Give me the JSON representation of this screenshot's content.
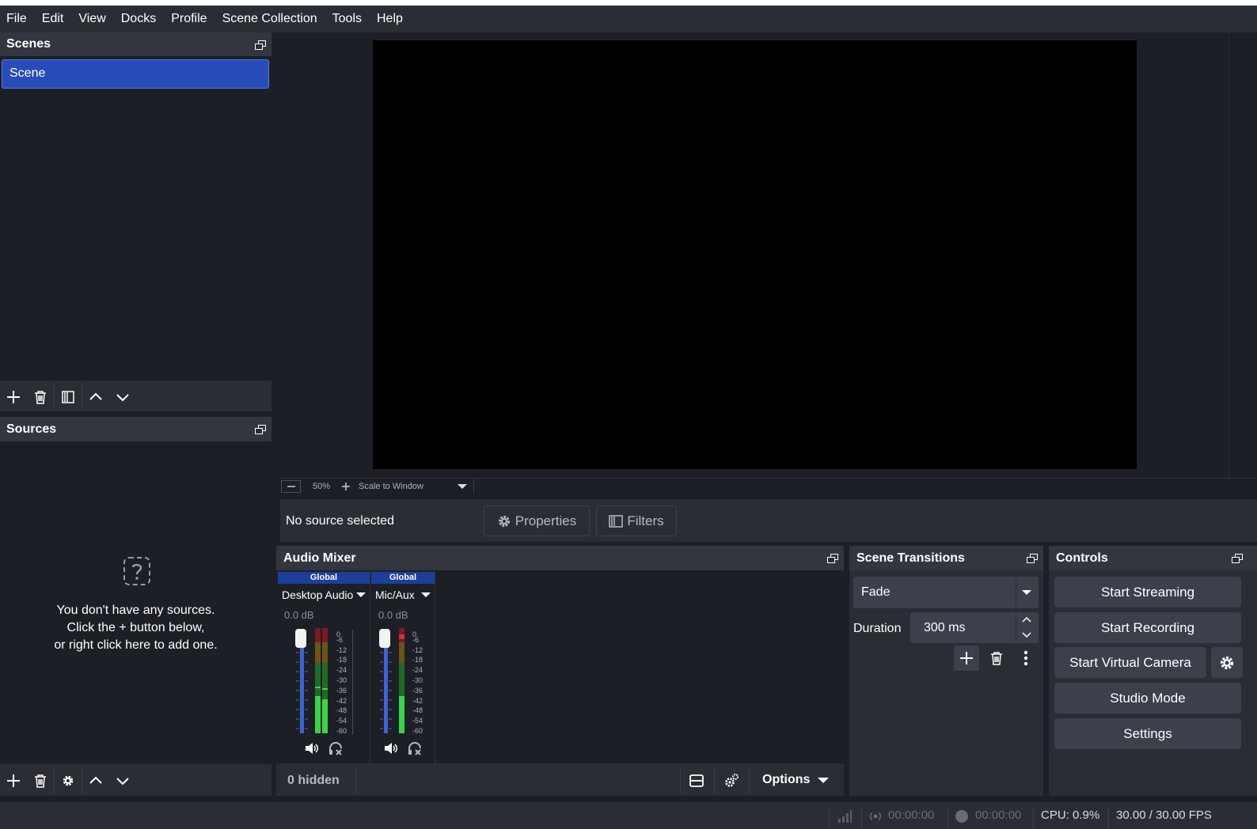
{
  "menu": [
    "File",
    "Edit",
    "View",
    "Docks",
    "Profile",
    "Scene Collection",
    "Tools",
    "Help"
  ],
  "scenes": {
    "title": "Scenes",
    "items": [
      "Scene"
    ]
  },
  "sources": {
    "title": "Sources",
    "empty_hint": [
      "You don't have any sources.",
      "Click the + button below,",
      "or right click here to add one."
    ]
  },
  "preview": {
    "zoom": "50%",
    "scale_mode": "Scale to Window"
  },
  "context_bar": {
    "no_source": "No source selected",
    "properties": "Properties",
    "filters": "Filters"
  },
  "audio_mixer": {
    "title": "Audio Mixer",
    "channels": [
      {
        "badge": "Global",
        "name": "Desktop Audio",
        "db": "0.0 dB"
      },
      {
        "badge": "Global",
        "name": "Mic/Aux",
        "db": "0.0 dB"
      }
    ],
    "ticks": [
      "0",
      "-6",
      "-12",
      "-18",
      "-24",
      "-30",
      "-36",
      "-42",
      "-48",
      "-54",
      "-60"
    ],
    "hidden": "0 hidden",
    "options": "Options"
  },
  "transitions": {
    "title": "Scene Transitions",
    "selected": "Fade",
    "duration_label": "Duration",
    "duration_value": "300 ms"
  },
  "controls": {
    "title": "Controls",
    "start_streaming": "Start Streaming",
    "start_recording": "Start Recording",
    "start_virtual_camera": "Start Virtual Camera",
    "studio_mode": "Studio Mode",
    "settings": "Settings"
  },
  "status": {
    "stream_time": "00:00:00",
    "record_time": "00:00:00",
    "cpu": "CPU: 0.9%",
    "fps": "30.00 / 30.00 FPS"
  },
  "colors": {
    "accent": "#284cb8",
    "panel": "#2a2d34",
    "background": "#1d1f26"
  }
}
